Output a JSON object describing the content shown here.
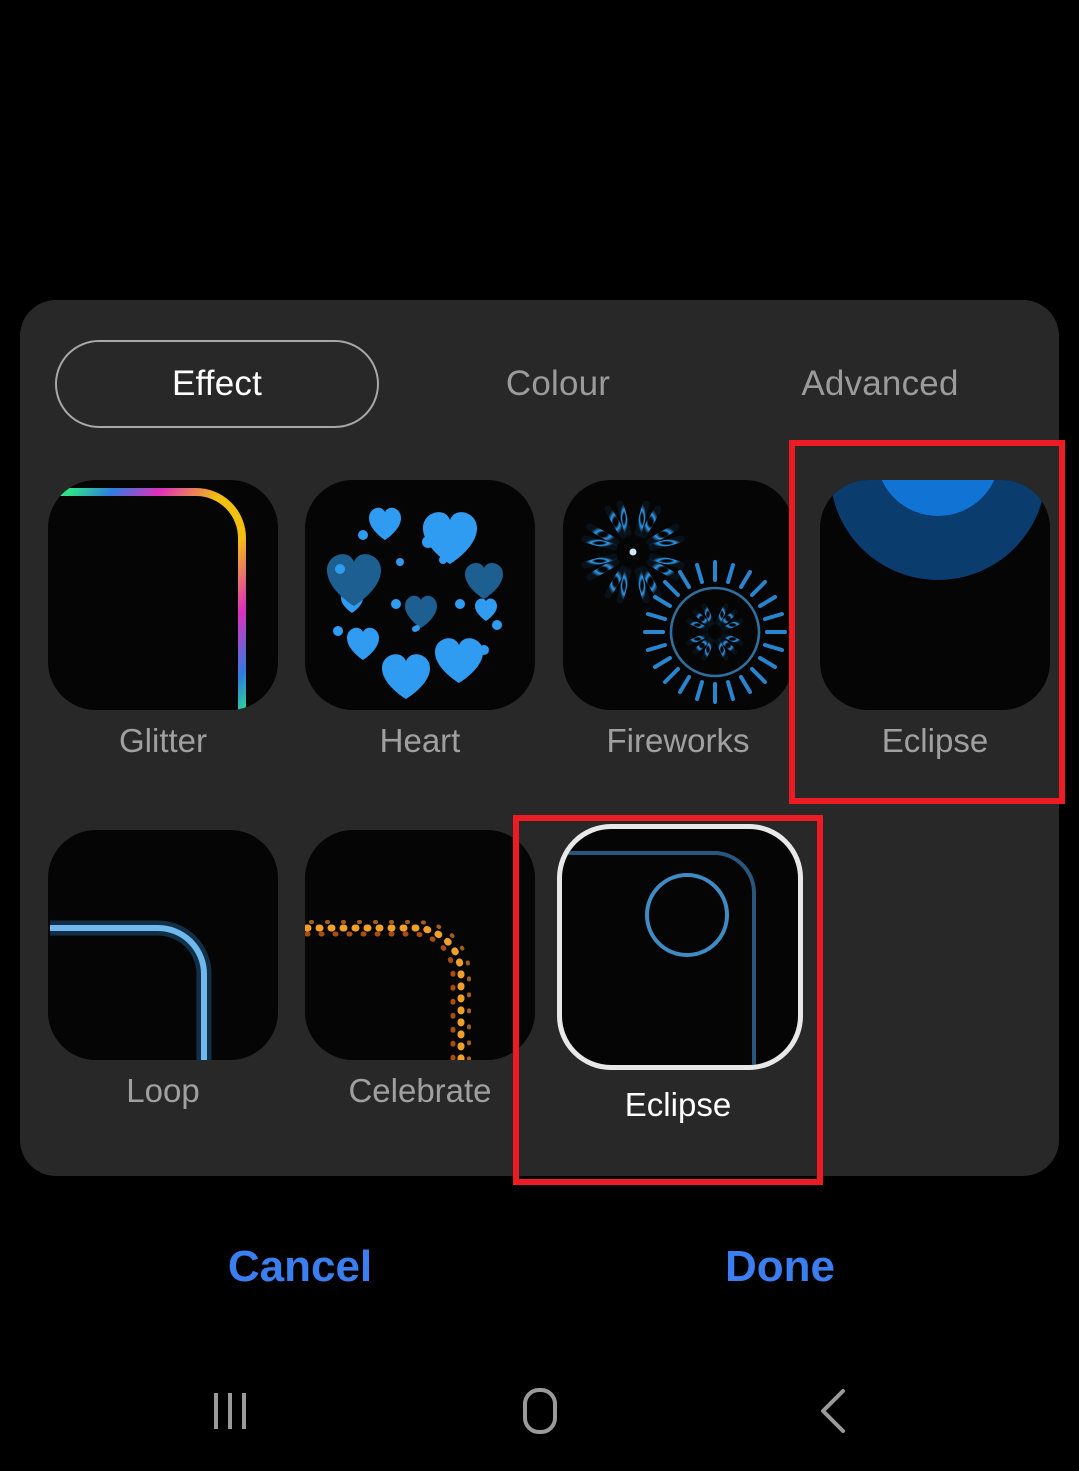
{
  "screen": {
    "background_color": "#000000",
    "panel_background_color": "#282828",
    "accent_color": "#3b7ef0",
    "annotation_color": "#ed1c24"
  },
  "tabs": [
    {
      "label": "Effect",
      "selected": true
    },
    {
      "label": "Colour",
      "selected": false
    },
    {
      "label": "Advanced",
      "selected": false
    }
  ],
  "effects": {
    "row1": [
      {
        "label": "Glitter",
        "art": "rainbow-corner",
        "selected": false
      },
      {
        "label": "Heart",
        "art": "hearts",
        "selected": false
      },
      {
        "label": "Fireworks",
        "art": "fireworks",
        "selected": false
      },
      {
        "label": "Eclipse",
        "art": "eclipse-circles",
        "selected": false
      }
    ],
    "row2": [
      {
        "label": "Loop",
        "art": "blue-corner",
        "selected": false
      },
      {
        "label": "Celebrate",
        "art": "orange-dots",
        "selected": false
      },
      {
        "label": "Eclipse",
        "art": "eclipse-ring",
        "selected": true
      }
    ]
  },
  "actions": {
    "cancel_label": "Cancel",
    "done_label": "Done"
  },
  "navigation": {
    "recents_label": "Recents",
    "home_label": "Home",
    "back_label": "Back"
  }
}
